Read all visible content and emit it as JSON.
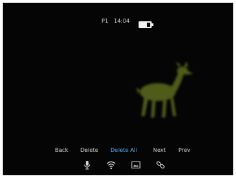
{
  "status": {
    "profile": "P1",
    "time": "14:04",
    "battery_icon": "battery-icon"
  },
  "menu": {
    "items": [
      {
        "label": "Back"
      },
      {
        "label": "Delete"
      },
      {
        "label": "Delete All",
        "selected": true
      },
      {
        "label": "Next"
      },
      {
        "label": "Prev"
      }
    ]
  },
  "icons": [
    "microphone-icon",
    "wifi-icon",
    "image-icon",
    "link-icon"
  ],
  "colors": {
    "background": "#050505",
    "text": "#d0d0d0",
    "selected": "#5aa0e6",
    "thermal_image": "#5b6a1f"
  }
}
